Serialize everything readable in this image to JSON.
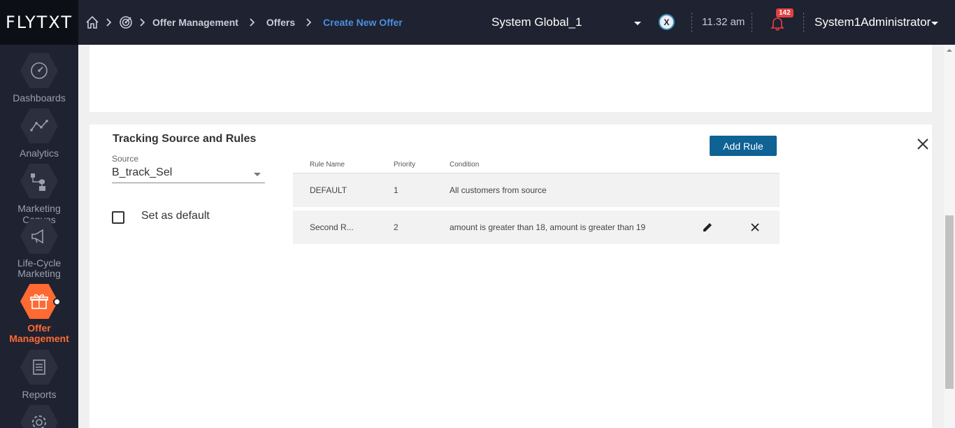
{
  "app": {
    "logo": "FLYTXT"
  },
  "breadcrumb": {
    "items": [
      "Offer Management",
      "Offers",
      "Create New Offer"
    ]
  },
  "header": {
    "scope": "System Global_1",
    "time": "11.32 am",
    "notification_count": "142",
    "user": "System1Administrator"
  },
  "sidebar": {
    "items": [
      {
        "label": "Dashboards",
        "icon": "gauge-icon"
      },
      {
        "label": "Analytics",
        "icon": "line-chart-icon"
      },
      {
        "label": "Marketing Canvas",
        "icon": "flow-diagram-icon"
      },
      {
        "label": "Life-Cycle Marketing",
        "icon": "megaphone-icon"
      },
      {
        "label": "Offer Management",
        "icon": "gift-icon",
        "active": true
      },
      {
        "label": "Reports",
        "icon": "document-icon"
      },
      {
        "label": "",
        "icon": "gear-icon"
      }
    ]
  },
  "tracking": {
    "title": "Tracking Source and Rules",
    "source_label": "Source",
    "source_value": "B_track_Sel",
    "default_label": "Set as default",
    "add_rule": "Add Rule",
    "columns": [
      "Rule Name",
      "Priority",
      "Condition"
    ],
    "rows": [
      {
        "name": "DEFAULT",
        "priority": "1",
        "condition": "All customers from source"
      },
      {
        "name": "Second R...",
        "priority": "2",
        "condition": "amount is greater than 18, amount is greater than 19"
      }
    ]
  },
  "colors": {
    "accent": "#ff6a33",
    "primary_button": "#0e6294",
    "topbar": "#1f2230",
    "link": "#4a8fe0"
  }
}
